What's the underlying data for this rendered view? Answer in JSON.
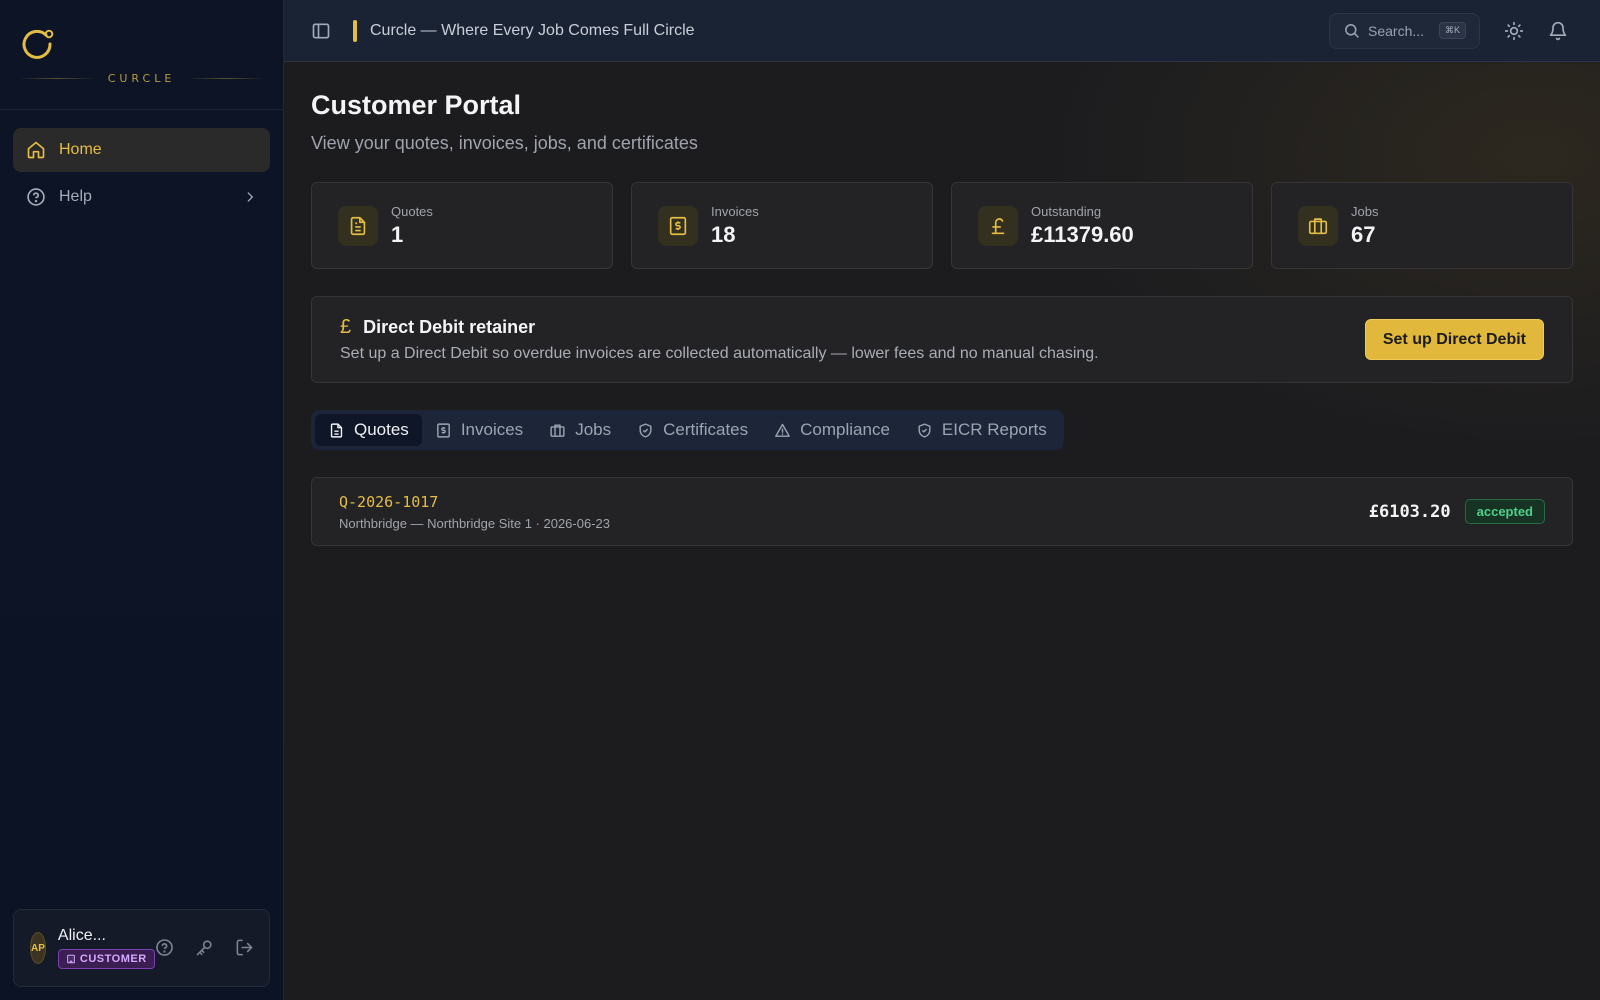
{
  "brand": {
    "name": "CURCLE",
    "accent_color": "#e4bd45"
  },
  "sidebar": {
    "items": [
      {
        "label": "Home",
        "icon": "home-icon",
        "active": true
      },
      {
        "label": "Help",
        "icon": "help-circle-icon",
        "active": false
      }
    ]
  },
  "user": {
    "initials": "AP",
    "name": "Alice...",
    "role": "CUSTOMER"
  },
  "topbar": {
    "title": "Curcle — Where Every Job Comes Full Circle",
    "search_placeholder": "Search...",
    "search_shortcut": "⌘K"
  },
  "page": {
    "title": "Customer Portal",
    "subtitle": "View your quotes, invoices, jobs, and certificates"
  },
  "stats": [
    {
      "label": "Quotes",
      "value": "1",
      "icon": "document-icon"
    },
    {
      "label": "Invoices",
      "value": "18",
      "icon": "receipt-icon"
    },
    {
      "label": "Outstanding",
      "value": "£11379.60",
      "icon": "pound-icon"
    },
    {
      "label": "Jobs",
      "value": "67",
      "icon": "briefcase-icon"
    }
  ],
  "direct_debit": {
    "symbol": "£",
    "title": "Direct Debit retainer",
    "text": "Set up a Direct Debit so overdue invoices are collected automatically — lower fees and no manual chasing.",
    "button": "Set up Direct Debit"
  },
  "tabs": [
    {
      "label": "Quotes",
      "icon": "document-icon",
      "active": true
    },
    {
      "label": "Invoices",
      "icon": "receipt-icon",
      "active": false
    },
    {
      "label": "Jobs",
      "icon": "briefcase-icon",
      "active": false
    },
    {
      "label": "Certificates",
      "icon": "shield-icon",
      "active": false
    },
    {
      "label": "Compliance",
      "icon": "warning-icon",
      "active": false
    },
    {
      "label": "EICR Reports",
      "icon": "shield-check-icon",
      "active": false
    }
  ],
  "quotes": [
    {
      "id": "Q-2026-1017",
      "meta": "Northbridge — Northbridge Site 1 · 2026-06-23",
      "amount": "£6103.20",
      "status": "accepted"
    }
  ]
}
